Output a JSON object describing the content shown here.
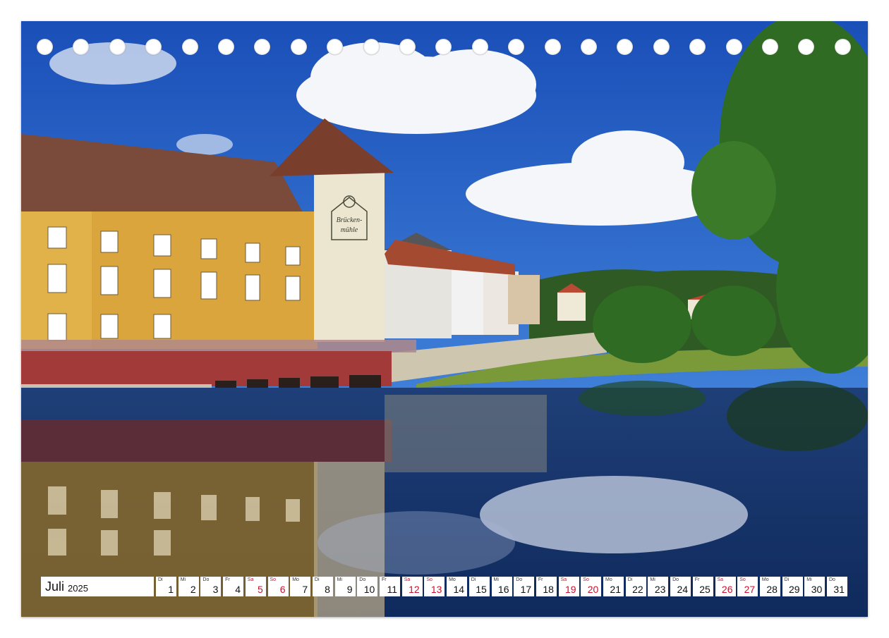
{
  "photo": {
    "sign_text_line1": "Brücken-",
    "sign_text_line2": "mühle",
    "colors": {
      "sky": "#1f5cc4",
      "water": "#16356e",
      "facade": "#d9a53c",
      "foundation": "#a23a3a",
      "tower": "#ece6d0",
      "roof": "#7a4a3a",
      "foliage": "#2f6b22"
    }
  },
  "binding_holes": 23,
  "calendar": {
    "month": "Juli",
    "year": "2025",
    "weekend_color": "#c8102e",
    "days": [
      {
        "wd": "Di",
        "num": "1",
        "we": false
      },
      {
        "wd": "Mi",
        "num": "2",
        "we": false
      },
      {
        "wd": "Do",
        "num": "3",
        "we": false
      },
      {
        "wd": "Fr",
        "num": "4",
        "we": false
      },
      {
        "wd": "Sa",
        "num": "5",
        "we": true
      },
      {
        "wd": "So",
        "num": "6",
        "we": true
      },
      {
        "wd": "Mo",
        "num": "7",
        "we": false
      },
      {
        "wd": "Di",
        "num": "8",
        "we": false
      },
      {
        "wd": "Mi",
        "num": "9",
        "we": false
      },
      {
        "wd": "Do",
        "num": "10",
        "we": false
      },
      {
        "wd": "Fr",
        "num": "11",
        "we": false
      },
      {
        "wd": "Sa",
        "num": "12",
        "we": true
      },
      {
        "wd": "So",
        "num": "13",
        "we": true
      },
      {
        "wd": "Mo",
        "num": "14",
        "we": false
      },
      {
        "wd": "Di",
        "num": "15",
        "we": false
      },
      {
        "wd": "Mi",
        "num": "16",
        "we": false
      },
      {
        "wd": "Do",
        "num": "17",
        "we": false
      },
      {
        "wd": "Fr",
        "num": "18",
        "we": false
      },
      {
        "wd": "Sa",
        "num": "19",
        "we": true
      },
      {
        "wd": "So",
        "num": "20",
        "we": true
      },
      {
        "wd": "Mo",
        "num": "21",
        "we": false
      },
      {
        "wd": "Di",
        "num": "22",
        "we": false
      },
      {
        "wd": "Mi",
        "num": "23",
        "we": false
      },
      {
        "wd": "Do",
        "num": "24",
        "we": false
      },
      {
        "wd": "Fr",
        "num": "25",
        "we": false
      },
      {
        "wd": "Sa",
        "num": "26",
        "we": true
      },
      {
        "wd": "So",
        "num": "27",
        "we": true
      },
      {
        "wd": "Mo",
        "num": "28",
        "we": false
      },
      {
        "wd": "Di",
        "num": "29",
        "we": false
      },
      {
        "wd": "Mi",
        "num": "30",
        "we": false
      },
      {
        "wd": "Do",
        "num": "31",
        "we": false
      }
    ]
  }
}
